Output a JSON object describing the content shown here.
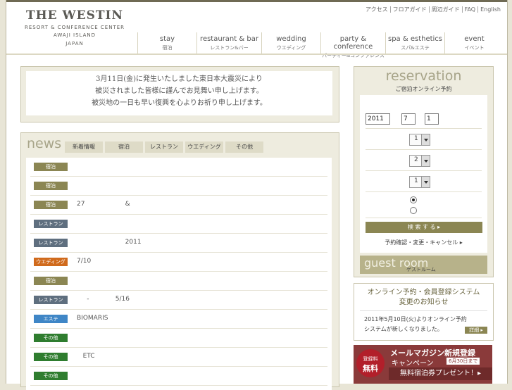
{
  "header": {
    "brand": "THE WESTIN",
    "subtitle": "RESORT & CONFERENCE CENTER",
    "location_1": "AWAJI ISLAND",
    "location_2": "JAPAN",
    "utility_links": [
      "アクセス",
      "フロアガイド",
      "周辺ガイド",
      "FAQ",
      "English"
    ]
  },
  "nav": [
    {
      "en": "stay",
      "ja": "宿泊"
    },
    {
      "en": "restaurant & bar",
      "ja": "レストラン&バー"
    },
    {
      "en": "wedding",
      "ja": "ウエディング"
    },
    {
      "en": "party & conference",
      "ja": "パーティー&コンファレンス"
    },
    {
      "en": "spa & esthetics",
      "ja": "スパ&エステ"
    },
    {
      "en": "event",
      "ja": "イベント"
    }
  ],
  "notice": {
    "line1": "3月11日(金)に発生いたしました東日本大震災により",
    "line2": "被災されました皆様に謹んでお見舞い申し上げます。",
    "line3": "被災地の一日も早い復興を心よりお祈り申し上げます。"
  },
  "news": {
    "title": "news",
    "tabs": [
      "新着情報",
      "宿泊",
      "レストラン",
      "ウエディング",
      "その他"
    ],
    "rows": [
      {
        "badge": "宿泊",
        "color": "#8b8653",
        "text": ""
      },
      {
        "badge": "宿泊",
        "color": "#8b8653",
        "text": ""
      },
      {
        "badge": "宿泊",
        "color": "#8b8653",
        "text": "27                    &"
      },
      {
        "badge": "レストラン",
        "color": "#5f6f7f",
        "text": ""
      },
      {
        "badge": "レストラン",
        "color": "#5f6f7f",
        "text": "                        2011"
      },
      {
        "badge": "ウエディング",
        "color": "#d06a1c",
        "text": "7/10"
      },
      {
        "badge": "宿泊",
        "color": "#8b8653",
        "text": ""
      },
      {
        "badge": "レストラン",
        "color": "#5f6f7f",
        "text": "     -             5/16"
      },
      {
        "badge": "エステ",
        "color": "#3f86c6",
        "text": "BIOMARIS"
      },
      {
        "badge": "その他",
        "color": "#2f7d2f",
        "text": ""
      },
      {
        "badge": "その他",
        "color": "#2f7d2f",
        "text": "   ETC"
      },
      {
        "badge": "その他",
        "color": "#2f7d2f",
        "text": ""
      }
    ]
  },
  "reservation": {
    "title": "reservation",
    "subtitle": "ご宿泊オンライン予約",
    "year": "2011",
    "month": "7",
    "day": "1",
    "select_1": "1",
    "select_2": "2",
    "select_3": "1",
    "search_label": "検 索 す る ▸",
    "confirm_label": "予約確認・変更・キャンセル ▸",
    "guest_en": "guest room",
    "guest_ja": "ゲストルーム"
  },
  "online": {
    "heading_1": "オンライン予約・会員登録システム",
    "heading_2": "変更のお知らせ",
    "body_1": "2011年5月10日(火)よりオンライン予約",
    "body_2": "システムが新しくなりました。",
    "more_label": "詳細 ▸"
  },
  "mail": {
    "badge_1": "登録料",
    "badge_2": "無料",
    "title": "メールマガジン新規登録",
    "campaign": "キャンペーン",
    "deadline": "6月30日まで",
    "offer": "無料宿泊券プレゼント！▸"
  }
}
